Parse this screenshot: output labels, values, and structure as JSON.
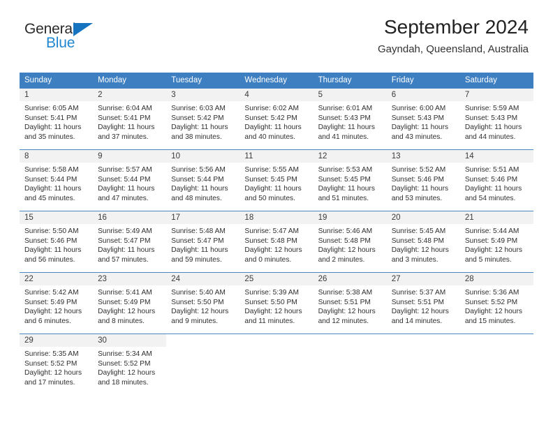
{
  "logo": {
    "word_top": "General",
    "word_bottom": "Blue",
    "triangle_color": "#1573c0",
    "text_color_top": "#2b2b2b",
    "text_color_bottom": "#1f86d0"
  },
  "header": {
    "title": "September 2024",
    "subtitle": "Gayndah, Queensland, Australia"
  },
  "theme": {
    "header_bg": "#3d7fc1",
    "header_text": "#ffffff",
    "cell_border": "#4a86c5",
    "daynum_bg": "#f2f2f2"
  },
  "columns": [
    "Sunday",
    "Monday",
    "Tuesday",
    "Wednesday",
    "Thursday",
    "Friday",
    "Saturday"
  ],
  "weeks": [
    [
      {
        "day": "1",
        "sunrise": "Sunrise: 6:05 AM",
        "sunset": "Sunset: 5:41 PM",
        "daylight1": "Daylight: 11 hours",
        "daylight2": "and 35 minutes."
      },
      {
        "day": "2",
        "sunrise": "Sunrise: 6:04 AM",
        "sunset": "Sunset: 5:41 PM",
        "daylight1": "Daylight: 11 hours",
        "daylight2": "and 37 minutes."
      },
      {
        "day": "3",
        "sunrise": "Sunrise: 6:03 AM",
        "sunset": "Sunset: 5:42 PM",
        "daylight1": "Daylight: 11 hours",
        "daylight2": "and 38 minutes."
      },
      {
        "day": "4",
        "sunrise": "Sunrise: 6:02 AM",
        "sunset": "Sunset: 5:42 PM",
        "daylight1": "Daylight: 11 hours",
        "daylight2": "and 40 minutes."
      },
      {
        "day": "5",
        "sunrise": "Sunrise: 6:01 AM",
        "sunset": "Sunset: 5:43 PM",
        "daylight1": "Daylight: 11 hours",
        "daylight2": "and 41 minutes."
      },
      {
        "day": "6",
        "sunrise": "Sunrise: 6:00 AM",
        "sunset": "Sunset: 5:43 PM",
        "daylight1": "Daylight: 11 hours",
        "daylight2": "and 43 minutes."
      },
      {
        "day": "7",
        "sunrise": "Sunrise: 5:59 AM",
        "sunset": "Sunset: 5:43 PM",
        "daylight1": "Daylight: 11 hours",
        "daylight2": "and 44 minutes."
      }
    ],
    [
      {
        "day": "8",
        "sunrise": "Sunrise: 5:58 AM",
        "sunset": "Sunset: 5:44 PM",
        "daylight1": "Daylight: 11 hours",
        "daylight2": "and 45 minutes."
      },
      {
        "day": "9",
        "sunrise": "Sunrise: 5:57 AM",
        "sunset": "Sunset: 5:44 PM",
        "daylight1": "Daylight: 11 hours",
        "daylight2": "and 47 minutes."
      },
      {
        "day": "10",
        "sunrise": "Sunrise: 5:56 AM",
        "sunset": "Sunset: 5:44 PM",
        "daylight1": "Daylight: 11 hours",
        "daylight2": "and 48 minutes."
      },
      {
        "day": "11",
        "sunrise": "Sunrise: 5:55 AM",
        "sunset": "Sunset: 5:45 PM",
        "daylight1": "Daylight: 11 hours",
        "daylight2": "and 50 minutes."
      },
      {
        "day": "12",
        "sunrise": "Sunrise: 5:53 AM",
        "sunset": "Sunset: 5:45 PM",
        "daylight1": "Daylight: 11 hours",
        "daylight2": "and 51 minutes."
      },
      {
        "day": "13",
        "sunrise": "Sunrise: 5:52 AM",
        "sunset": "Sunset: 5:46 PM",
        "daylight1": "Daylight: 11 hours",
        "daylight2": "and 53 minutes."
      },
      {
        "day": "14",
        "sunrise": "Sunrise: 5:51 AM",
        "sunset": "Sunset: 5:46 PM",
        "daylight1": "Daylight: 11 hours",
        "daylight2": "and 54 minutes."
      }
    ],
    [
      {
        "day": "15",
        "sunrise": "Sunrise: 5:50 AM",
        "sunset": "Sunset: 5:46 PM",
        "daylight1": "Daylight: 11 hours",
        "daylight2": "and 56 minutes."
      },
      {
        "day": "16",
        "sunrise": "Sunrise: 5:49 AM",
        "sunset": "Sunset: 5:47 PM",
        "daylight1": "Daylight: 11 hours",
        "daylight2": "and 57 minutes."
      },
      {
        "day": "17",
        "sunrise": "Sunrise: 5:48 AM",
        "sunset": "Sunset: 5:47 PM",
        "daylight1": "Daylight: 11 hours",
        "daylight2": "and 59 minutes."
      },
      {
        "day": "18",
        "sunrise": "Sunrise: 5:47 AM",
        "sunset": "Sunset: 5:48 PM",
        "daylight1": "Daylight: 12 hours",
        "daylight2": "and 0 minutes."
      },
      {
        "day": "19",
        "sunrise": "Sunrise: 5:46 AM",
        "sunset": "Sunset: 5:48 PM",
        "daylight1": "Daylight: 12 hours",
        "daylight2": "and 2 minutes."
      },
      {
        "day": "20",
        "sunrise": "Sunrise: 5:45 AM",
        "sunset": "Sunset: 5:48 PM",
        "daylight1": "Daylight: 12 hours",
        "daylight2": "and 3 minutes."
      },
      {
        "day": "21",
        "sunrise": "Sunrise: 5:44 AM",
        "sunset": "Sunset: 5:49 PM",
        "daylight1": "Daylight: 12 hours",
        "daylight2": "and 5 minutes."
      }
    ],
    [
      {
        "day": "22",
        "sunrise": "Sunrise: 5:42 AM",
        "sunset": "Sunset: 5:49 PM",
        "daylight1": "Daylight: 12 hours",
        "daylight2": "and 6 minutes."
      },
      {
        "day": "23",
        "sunrise": "Sunrise: 5:41 AM",
        "sunset": "Sunset: 5:49 PM",
        "daylight1": "Daylight: 12 hours",
        "daylight2": "and 8 minutes."
      },
      {
        "day": "24",
        "sunrise": "Sunrise: 5:40 AM",
        "sunset": "Sunset: 5:50 PM",
        "daylight1": "Daylight: 12 hours",
        "daylight2": "and 9 minutes."
      },
      {
        "day": "25",
        "sunrise": "Sunrise: 5:39 AM",
        "sunset": "Sunset: 5:50 PM",
        "daylight1": "Daylight: 12 hours",
        "daylight2": "and 11 minutes."
      },
      {
        "day": "26",
        "sunrise": "Sunrise: 5:38 AM",
        "sunset": "Sunset: 5:51 PM",
        "daylight1": "Daylight: 12 hours",
        "daylight2": "and 12 minutes."
      },
      {
        "day": "27",
        "sunrise": "Sunrise: 5:37 AM",
        "sunset": "Sunset: 5:51 PM",
        "daylight1": "Daylight: 12 hours",
        "daylight2": "and 14 minutes."
      },
      {
        "day": "28",
        "sunrise": "Sunrise: 5:36 AM",
        "sunset": "Sunset: 5:52 PM",
        "daylight1": "Daylight: 12 hours",
        "daylight2": "and 15 minutes."
      }
    ],
    [
      {
        "day": "29",
        "sunrise": "Sunrise: 5:35 AM",
        "sunset": "Sunset: 5:52 PM",
        "daylight1": "Daylight: 12 hours",
        "daylight2": "and 17 minutes."
      },
      {
        "day": "30",
        "sunrise": "Sunrise: 5:34 AM",
        "sunset": "Sunset: 5:52 PM",
        "daylight1": "Daylight: 12 hours",
        "daylight2": "and 18 minutes."
      },
      {
        "day": "",
        "sunrise": "",
        "sunset": "",
        "daylight1": "",
        "daylight2": ""
      },
      {
        "day": "",
        "sunrise": "",
        "sunset": "",
        "daylight1": "",
        "daylight2": ""
      },
      {
        "day": "",
        "sunrise": "",
        "sunset": "",
        "daylight1": "",
        "daylight2": ""
      },
      {
        "day": "",
        "sunrise": "",
        "sunset": "",
        "daylight1": "",
        "daylight2": ""
      },
      {
        "day": "",
        "sunrise": "",
        "sunset": "",
        "daylight1": "",
        "daylight2": ""
      }
    ]
  ]
}
